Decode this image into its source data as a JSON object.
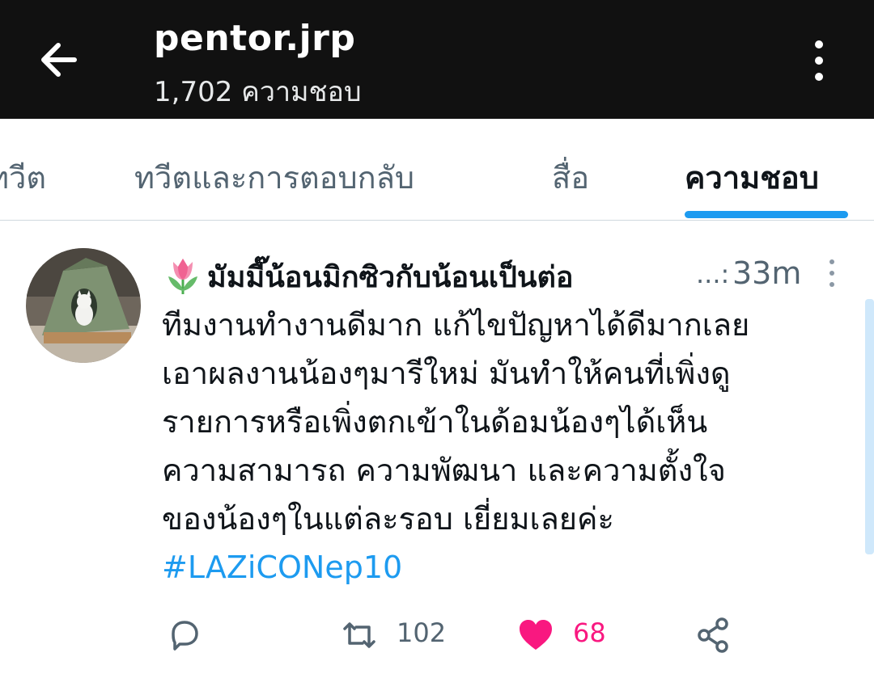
{
  "header": {
    "title": "pentor.jrp",
    "subtitle": "1,702 ความชอบ",
    "back_icon": "arrow-left-icon",
    "more_icon": "more-vertical-icon"
  },
  "tabs": [
    {
      "label": "ทวีต",
      "active": false
    },
    {
      "label": "ทวีตและการตอบกลับ",
      "active": false
    },
    {
      "label": "สื่อ",
      "active": false
    },
    {
      "label": "ความชอบ",
      "active": true
    }
  ],
  "tweet": {
    "emoji_icon": "tulip-icon",
    "display_name": "มัมมี๊น้อนมิกซิวกับน้อนเป็นต่อ",
    "ellipsis": "...:",
    "timestamp": "33m",
    "text_lines": [
      "ทีมงานทำงานดีมาก แก้ไขปัญหาได้ดีมากเลย",
      "เอาผลงานน้องๆมารีใหม่ มันทำให้คนที่เพิ่งดู",
      "รายการหรือเพิ่งตกเข้าในด้อมน้องๆได้เห็น",
      "ความสามารถ ความพัฒนา และความตั้งใจ",
      "ของน้องๆในแต่ละรอบ เยี่ยมเลยค่ะ"
    ],
    "hashtag": "#LAZiCONep10",
    "actions": {
      "reply_icon": "reply-icon",
      "retweet_icon": "retweet-icon",
      "retweet_count": "102",
      "like_icon": "heart-icon",
      "like_count": "68",
      "share_icon": "share-icon"
    }
  },
  "colors": {
    "header_bg": "#111111",
    "accent": "#1d9bf0",
    "like": "#f91880",
    "muted": "#536471"
  }
}
